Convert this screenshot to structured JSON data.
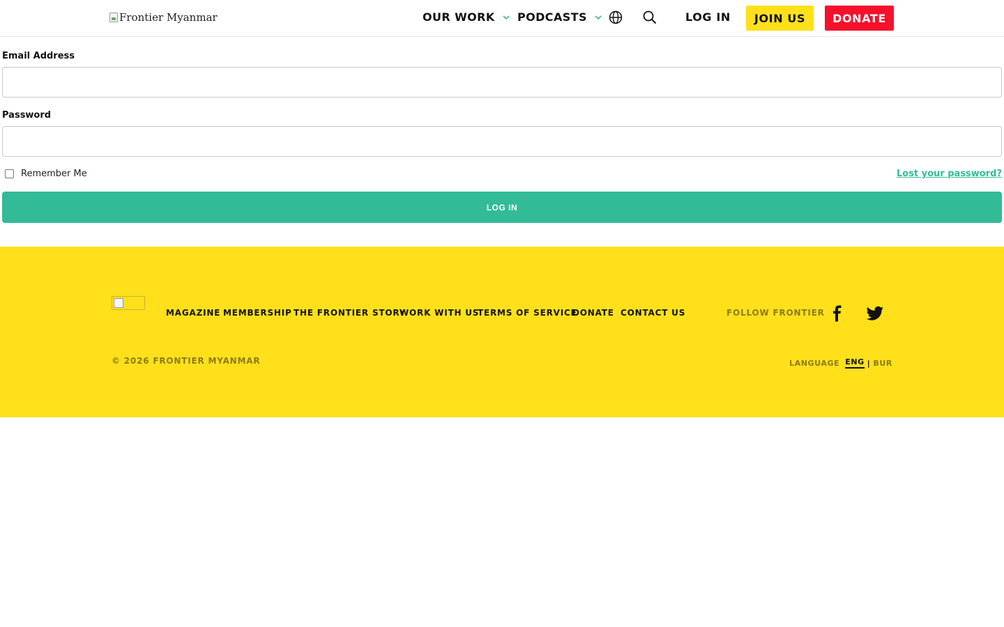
{
  "header": {
    "logo_alt": "Frontier Myanmar",
    "nav": [
      {
        "label": "OUR WORK"
      },
      {
        "label": "PODCASTS"
      }
    ],
    "login_label": "LOG IN",
    "join_label": "JOIN US",
    "donate_label": "DONATE",
    "icons": [
      "globe-icon",
      "search-icon",
      "chevron-down-icon"
    ],
    "accent_color": "#32bb96",
    "join_color": "#ffe01b",
    "donate_color": "#f5112b"
  },
  "form": {
    "email_label": "Email Address",
    "email_value": "",
    "password_label": "Password",
    "password_value": "",
    "remember_label": "Remember Me",
    "remember_checked": false,
    "lost_password_label": "Lost your password?",
    "submit_label": "LOG IN"
  },
  "footer": {
    "links": [
      "MAGAZINE",
      "MEMBERSHIP",
      "THE FRONTIER STORY",
      "WORK WITH US",
      "TERMS OF SERVICE",
      "DONATE",
      "CONTACT US"
    ],
    "follow_label": "FOLLOW FRONTIER",
    "social": [
      "facebook-icon",
      "twitter-icon"
    ],
    "copyright": "© 2026 FRONTIER MYANMAR",
    "language_label": "LANGUAGE",
    "lang_eng": "ENG",
    "lang_sep": "|",
    "lang_bur": "BUR",
    "background_color": "#ffe01b"
  }
}
